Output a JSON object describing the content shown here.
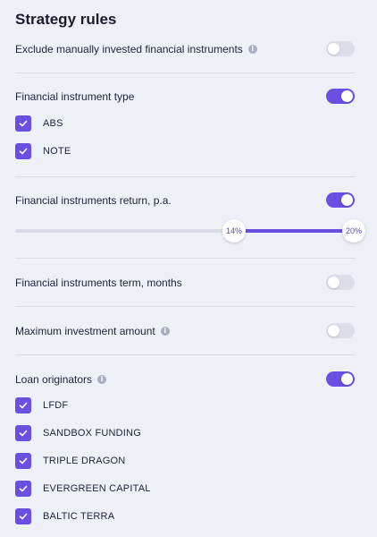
{
  "title": "Strategy rules",
  "rules": {
    "exclude_manual": {
      "label": "Exclude manually invested financial instruments",
      "enabled": false
    },
    "instrument_type": {
      "label": "Financial instrument type",
      "enabled": true,
      "options": [
        {
          "label": "ABS",
          "checked": true
        },
        {
          "label": "NOTE",
          "checked": true
        }
      ]
    },
    "return": {
      "label": "Financial instruments return, p.a.",
      "enabled": true,
      "min_label": "14%",
      "max_label": "20%",
      "min": 14,
      "max": 20
    },
    "term": {
      "label": "Financial instruments term, months",
      "enabled": false
    },
    "max_investment": {
      "label": "Maximum investment amount",
      "enabled": false
    },
    "loan_originators": {
      "label": "Loan originators",
      "enabled": true,
      "options": [
        {
          "label": "LFDF",
          "checked": true
        },
        {
          "label": "SANDBOX FUNDING",
          "checked": true
        },
        {
          "label": "TRIPLE DRAGON",
          "checked": true
        },
        {
          "label": "EVERGREEN CAPITAL",
          "checked": true
        },
        {
          "label": "BALTIC TERRA",
          "checked": true
        }
      ]
    }
  },
  "icons": {
    "info": "i",
    "check": "check-icon"
  },
  "colors": {
    "accent": "#6b4fe0",
    "background": "#eef0f8",
    "toggle_off": "#dcdde8"
  }
}
